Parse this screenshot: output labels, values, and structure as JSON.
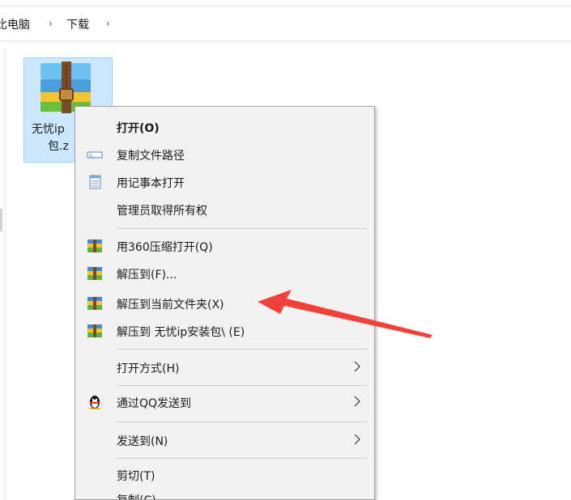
{
  "breadcrumb": {
    "items": [
      "此电脑",
      "下载"
    ],
    "separator": "›",
    "visible_first": "比电脑"
  },
  "file": {
    "name_line1": "无忧ip",
    "name_line2": "包.z"
  },
  "context_menu": {
    "open": "打开(O)",
    "copy_path": "复制文件路径",
    "open_notepad": "用记事本打开",
    "take_ownership": "管理员取得所有权",
    "open_360": "用360压缩打开(Q)",
    "extract_to": "解压到(F)...",
    "extract_here": "解压到当前文件夹(X)",
    "extract_named": "解压到 无忧ip安装包\\ (E)",
    "open_with": "打开方式(H)",
    "send_qq": "通过QQ发送到",
    "send_to": "发送到(N)",
    "cut": "剪切(T)",
    "copy_partial": "复制(C)"
  },
  "colors": {
    "selection_bg": "#cce8ff",
    "selection_border": "#99d1ff",
    "menu_bg": "#f2f2f2",
    "arrow": "#f0413b"
  },
  "icons": {
    "copy_path": "path-icon",
    "notepad": "notepad-icon",
    "archive": "archive-icon",
    "qq": "qq-penguin-icon",
    "submenu": "chevron-right-icon"
  }
}
